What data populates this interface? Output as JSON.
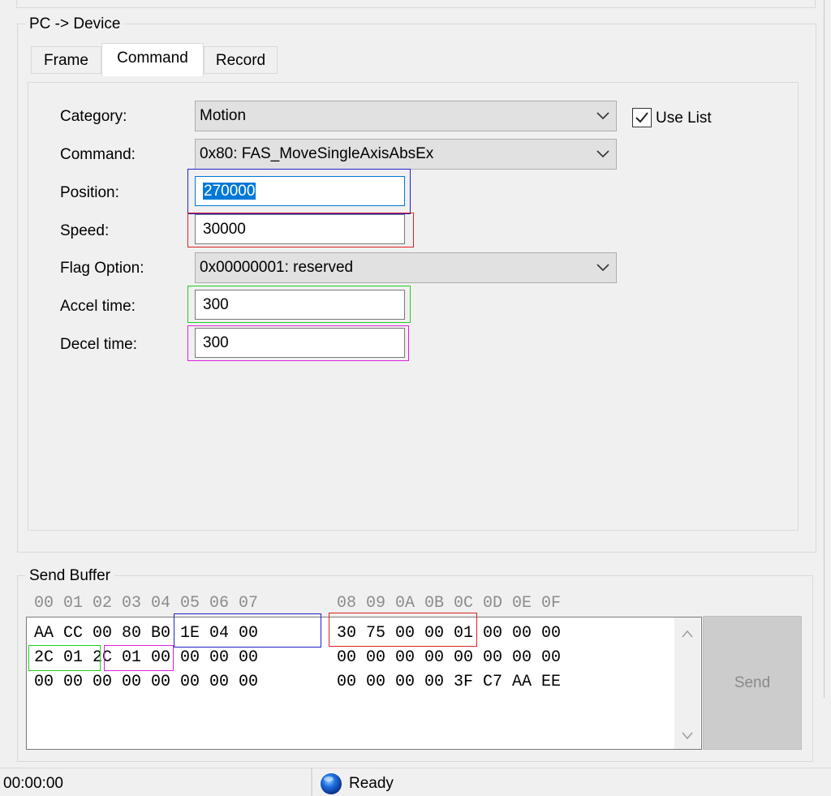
{
  "window": {
    "group_title": "PC -> Device"
  },
  "tabs": [
    {
      "label": "Frame",
      "active": false
    },
    {
      "label": "Command",
      "active": true
    },
    {
      "label": "Record",
      "active": false
    }
  ],
  "form": {
    "category_label": "Category:",
    "category_value": "Motion",
    "use_list_label": "Use List",
    "use_list_checked": true,
    "command_label": "Command:",
    "command_value": "0x80: FAS_MoveSingleAxisAbsEx",
    "position_label": "Position:",
    "position_value": "270000",
    "speed_label": "Speed:",
    "speed_value": "30000",
    "flag_label": "Flag Option:",
    "flag_value": "0x00000001: reserved",
    "accel_label": "Accel time:",
    "accel_value": "300",
    "decel_label": "Decel time:",
    "decel_value": "300"
  },
  "send_buffer": {
    "title": "Send Buffer",
    "header_a": "00 01 02 03 04 05 06 07",
    "header_b": "08 09 0A 0B 0C 0D 0E 0F",
    "rows": [
      [
        "AA CC 00 80 B0 1E 04 00",
        "30 75 00 00 01 00 00 00"
      ],
      [
        "2C 01 2C 01 00 00 00 00",
        "00 00 00 00 00 00 00 00"
      ],
      [
        "00 00 00 00 00 00 00 00",
        "00 00 00 00 3F C7 AA EE"
      ]
    ],
    "send_label": "Send"
  },
  "highlight_colors": {
    "position": "#2020d0",
    "speed": "#e02020",
    "accel": "#20d020",
    "decel": "#e020e0"
  },
  "status_bar": {
    "time": "00:00:00",
    "status": "Ready",
    "status_icon": "blue-orb-icon"
  }
}
